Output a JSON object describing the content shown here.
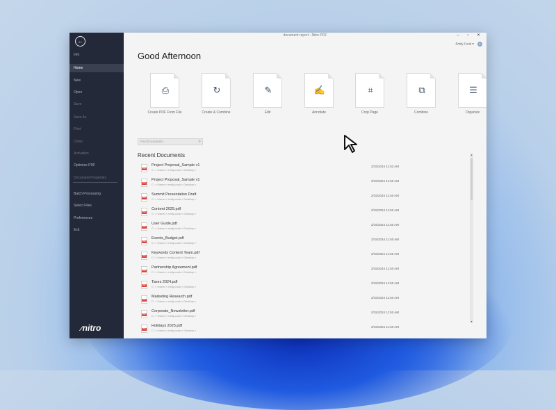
{
  "window": {
    "title": "document report - Nitro PDF",
    "controls": "– ▫ ✕"
  },
  "user": {
    "name": "Emily Cook ▾",
    "initials": "E"
  },
  "greeting": "Good Afternoon",
  "sidebar": {
    "items": [
      {
        "label": "Info",
        "state": "normal"
      },
      {
        "label": "Home",
        "state": "active"
      },
      {
        "label": "New",
        "state": "normal"
      },
      {
        "label": "Open",
        "state": "normal"
      },
      {
        "label": "Save",
        "state": "dim"
      },
      {
        "label": "Save As",
        "state": "dim"
      },
      {
        "label": "Print",
        "state": "dim"
      },
      {
        "label": "Close",
        "state": "dim"
      },
      {
        "label": "Activation",
        "state": "dim"
      },
      {
        "label": "Optimize PDF",
        "state": "normal"
      },
      {
        "label": "Document Properties",
        "state": "dim"
      },
      {
        "label": "Batch Processing",
        "state": "normal"
      },
      {
        "label": "Select Files",
        "state": "normal"
      },
      {
        "label": "Preferences",
        "state": "normal"
      },
      {
        "label": "Exit",
        "state": "normal"
      }
    ],
    "logo": "nitro"
  },
  "tiles": [
    {
      "label": "Create PDF From File",
      "icon": "create-pdf-icon",
      "glyph": "⎙"
    },
    {
      "label": "Create & Combine",
      "icon": "combine-create-icon",
      "glyph": "↻"
    },
    {
      "label": "Edit",
      "icon": "edit-icon",
      "glyph": "✎"
    },
    {
      "label": "Annotate",
      "icon": "annotate-icon",
      "glyph": "✍"
    },
    {
      "label": "Crop Page",
      "icon": "crop-icon",
      "glyph": "⌗"
    },
    {
      "label": "Combine",
      "icon": "combine-icon",
      "glyph": "⧉"
    },
    {
      "label": "Organize",
      "icon": "organize-icon",
      "glyph": "☰"
    }
  ],
  "search": {
    "placeholder": "Find Documents"
  },
  "recent": {
    "title": "Recent Documents",
    "documents": [
      {
        "name": "Project Proposal_Sample v1",
        "path": "C: » Users » emily.cook » Desktop »",
        "date": "2/15/2024 11:52 AM"
      },
      {
        "name": "Project Proposal_Sample v1",
        "path": "C: » Users » emily.cook » Desktop »",
        "date": "2/15/2024 11:50 AM"
      },
      {
        "name": "Summit Presentation Draft",
        "path": "C: » Users » emily.cook » Desktop »",
        "date": "2/15/2024 11:50 AM"
      },
      {
        "name": "Content 2025.pdf",
        "path": "C: » Users » emily.cook » Desktop »",
        "date": "2/15/2024 11:50 AM"
      },
      {
        "name": "User Guide.pdf",
        "path": "C: » Users » emily.cook » Desktop »",
        "date": "2/15/2024 11:50 AM"
      },
      {
        "name": "Events_Budget.pdf",
        "path": "C: » Users » emily.cook » Desktop »",
        "date": "2/15/2024 11:50 AM"
      },
      {
        "name": "Keywords Content Team.pdf",
        "path": "C: » Users » emily.cook » Desktop »",
        "date": "2/15/2024 11:50 AM"
      },
      {
        "name": "Partnership Agreement.pdf",
        "path": "C: » Users » emily.cook » Desktop »",
        "date": "2/15/2024 11:50 AM"
      },
      {
        "name": "Taxes 2024.pdf",
        "path": "C: » Users » emily.cook » Desktop »",
        "date": "2/15/2024 11:50 AM"
      },
      {
        "name": "Marketing Research.pdf",
        "path": "C: » Users » emily.cook » Desktop »",
        "date": "2/15/2024 11:50 AM"
      },
      {
        "name": "Corporate_Newsletter.pdf",
        "path": "C: » Users » emily.cook » Desktop »",
        "date": "2/15/2024 11:50 AM"
      },
      {
        "name": "Holidays 2025.pdf",
        "path": "C: » Users » emily.cook » Desktop »",
        "date": "2/15/2024 11:50 AM"
      }
    ]
  },
  "colors": {
    "sidebar": "#232938",
    "pdf_red": "#d9453b"
  }
}
